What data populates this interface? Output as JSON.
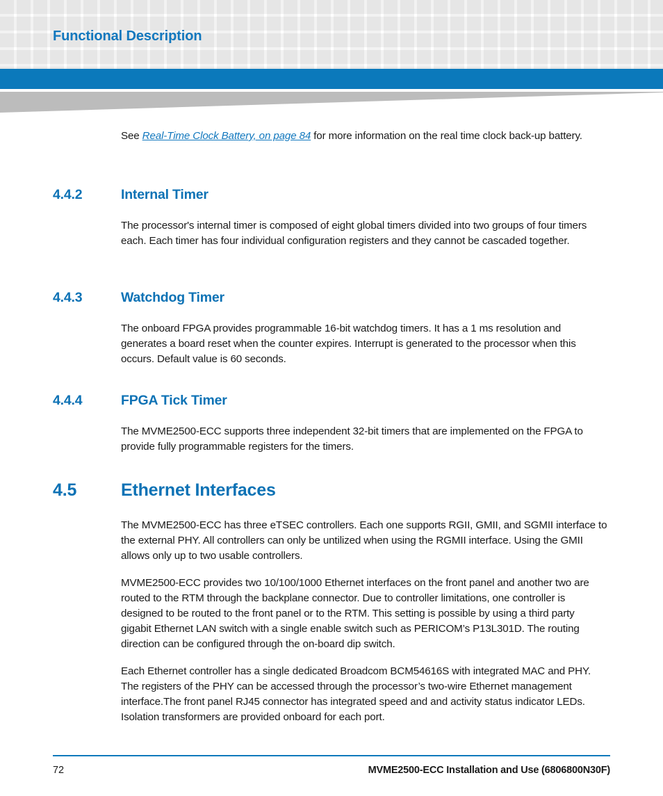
{
  "header": {
    "running_title": "Functional Description",
    "accent_blue": "#0b79bb",
    "title_blue": "#1278be",
    "grid_square_color": "#f2f2f2",
    "wedge_color": "#bcbcbc"
  },
  "intro": {
    "lead": "See ",
    "xref": "Real-Time Clock Battery, on page 84",
    "tail": " for more information on the real time clock back-up battery."
  },
  "sections": [
    {
      "number": "4.4.2",
      "title": "Internal Timer",
      "level": "sub",
      "paragraphs": [
        "The processor's internal timer is composed of eight global timers divided into two groups of four timers each. Each timer has four individual configuration registers and they cannot be cascaded together."
      ]
    },
    {
      "number": "4.4.3",
      "title": "Watchdog Timer",
      "level": "sub",
      "paragraphs": [
        "The onboard FPGA provides programmable 16-bit watchdog timers. It has a 1 ms resolution and generates a board reset when the counter expires. Interrupt is generated to the processor when this occurs. Default value is 60 seconds."
      ]
    },
    {
      "number": "4.4.4",
      "title": "FPGA Tick Timer",
      "level": "sub",
      "paragraphs": [
        "The MVME2500-ECC supports three independent 32-bit timers that are implemented on the FPGA to provide fully programmable registers for the timers."
      ]
    },
    {
      "number": "4.5",
      "title": "Ethernet Interfaces",
      "level": "main",
      "paragraphs": [
        "The MVME2500-ECC has three eTSEC controllers. Each one supports RGII, GMII, and SGMII interface to the external PHY. All controllers can only be untilized when using the RGMII interface. Using the GMII allows only up to two usable controllers.",
        "MVME2500-ECC provides two 10/100/1000 Ethernet interfaces on the front panel and another two are routed to the RTM through the backplane connector. Due to controller limitations, one controller is designed to be routed to the front panel or to the RTM. This setting is possible by using a third party gigabit Ethernet LAN switch with a single enable switch such as PERICOM’s P13L301D. The routing direction can be configured through the on-board dip switch.",
        "Each Ethernet controller has a single dedicated Broadcom BCM54616S with integrated MAC and PHY. The registers of the PHY can be accessed through the processor’s two-wire Ethernet management interface.The front panel RJ45 connector has integrated speed and and activity status indicator LEDs. Isolation transformers are provided onboard for each port."
      ]
    }
  ],
  "footer": {
    "page_number": "72",
    "document_title": "MVME2500-ECC Installation and Use (6806800N30F)"
  }
}
